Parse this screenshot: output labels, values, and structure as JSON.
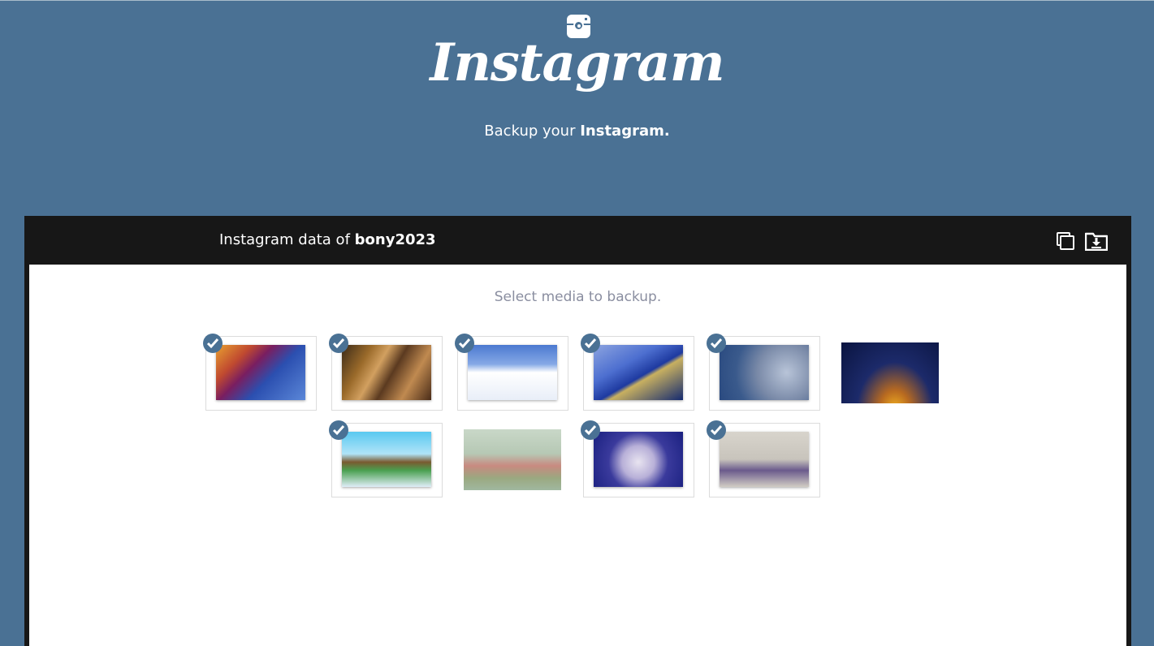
{
  "header": {
    "logo_text": "Instagram",
    "tagline_prefix": "Backup your",
    "tagline_brand": "Instagram.",
    "icon": "instagram-camera-icon"
  },
  "panel": {
    "title_prefix": "Instagram data of",
    "username": "bony2023",
    "copy_icon": "copy-icon",
    "download_icon": "download-folder-icon",
    "select_label": "Select media to backup."
  },
  "media": [
    {
      "id": "m1",
      "selected": true
    },
    {
      "id": "m2",
      "selected": true
    },
    {
      "id": "m3",
      "selected": true
    },
    {
      "id": "m4",
      "selected": true
    },
    {
      "id": "m5",
      "selected": true
    },
    {
      "id": "m6",
      "selected": false
    },
    {
      "id": "m7",
      "selected": true
    },
    {
      "id": "m8",
      "selected": false
    },
    {
      "id": "m9",
      "selected": true
    },
    {
      "id": "m10",
      "selected": true
    }
  ],
  "colors": {
    "background": "#4a7194",
    "panel_bar": "#171717",
    "check_badge": "#4a7194",
    "muted_text": "#8a8ea0"
  }
}
